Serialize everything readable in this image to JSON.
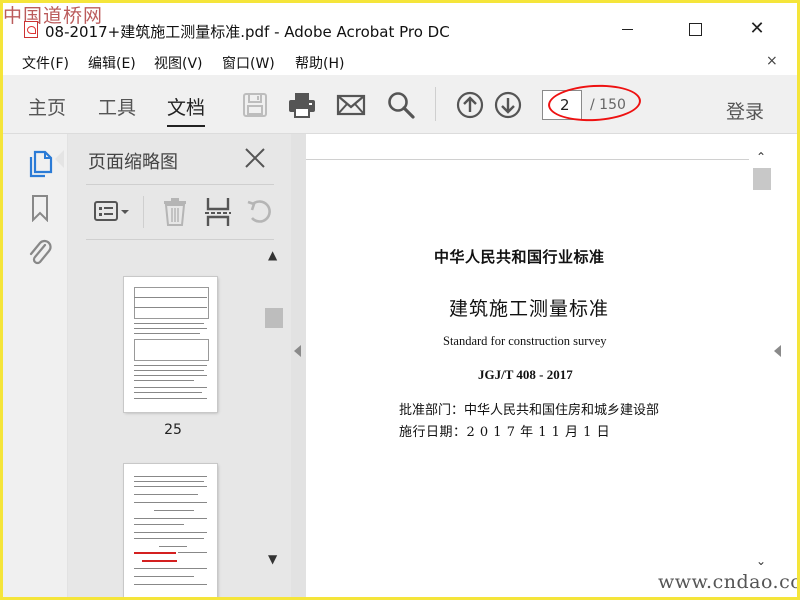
{
  "watermark_top": "中国道桥网",
  "watermark_bottom": "www.cndao.com",
  "window": {
    "title": "08-2017+建筑施工测量标准.pdf - Adobe Acrobat Pro DC",
    "close_glyph": "✕"
  },
  "menu": {
    "items": [
      "文件(F)",
      "编辑(E)",
      "视图(V)",
      "窗口(W)",
      "帮助(H)"
    ],
    "close_glyph": "×"
  },
  "toolbar": {
    "tabs": [
      "主页",
      "工具",
      "文档"
    ],
    "active_tab": "文档",
    "icons": [
      "save-icon",
      "print-icon",
      "email-icon",
      "search-icon",
      "page-up-icon",
      "page-down-icon"
    ],
    "page_current": "2",
    "page_total": "/ 150",
    "login_label": "登录"
  },
  "left_rail": {
    "icons": [
      "page-thumbnails-icon",
      "bookmark-icon",
      "attachment-icon"
    ]
  },
  "thumbnails_panel": {
    "title": "页面缩略图",
    "tools": [
      "options-menu-icon",
      "delete-icon",
      "crop-icon",
      "rotate-icon"
    ],
    "pages": [
      {
        "label": "25"
      }
    ]
  },
  "document": {
    "lines": {
      "h1": "中华人民共和国行业标准",
      "h2": "建筑施工测量标准",
      "english": "Standard for construction survey",
      "code": "JGJ/T 408 - 2017",
      "approve": "批准部门：中华人民共和国住房和城乡建设部",
      "effective": "施行日期：2 0 1 7 年 1 1 月 1 日"
    }
  },
  "colors": {
    "border_yellow": "#f5e53a",
    "annotation_red": "#e11111",
    "toolbar_bg": "#f0f0f0",
    "panel_bg": "#e7e7e7",
    "active_blue": "#2b7bd6"
  }
}
